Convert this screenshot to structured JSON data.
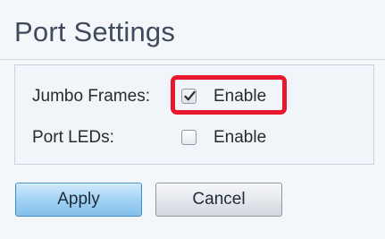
{
  "header": {
    "title": "Port Settings"
  },
  "settings": {
    "jumbo_frames": {
      "label": "Jumbo Frames:",
      "option_label": "Enable",
      "checked": true
    },
    "port_leds": {
      "label": "Port LEDs:",
      "option_label": "Enable",
      "checked": false
    }
  },
  "actions": {
    "apply_label": "Apply",
    "cancel_label": "Cancel"
  },
  "colors": {
    "highlight": "#e8192c",
    "apply_button": "#9fd0f2",
    "title_text": "#3f4b5c"
  },
  "icons": {
    "checkmark": "checkmark-icon"
  }
}
